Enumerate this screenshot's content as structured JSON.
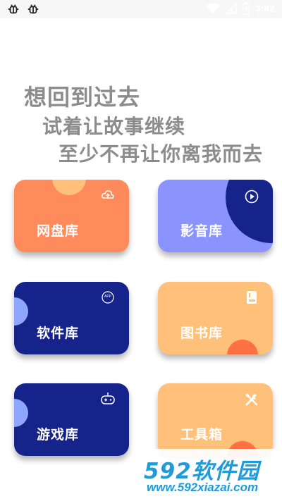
{
  "status_bar": {
    "time": "3:42",
    "left_icons": [
      "bug-icon",
      "bug-icon"
    ],
    "right_icons": [
      "wifi-icon",
      "signal-off-icon",
      "battery-charging-icon"
    ]
  },
  "quote": {
    "line1": "想回到过去",
    "line2": "试着让故事继续",
    "line3": "至少不再让你离我而去"
  },
  "cards": [
    {
      "label": "网盘库",
      "icon": "cloud-upload-icon",
      "bg": "#ff8a5b",
      "accent": "#ffc17a"
    },
    {
      "label": "影音库",
      "icon": "play-circle-icon",
      "bg": "#8b93ff",
      "accent": "#16238a"
    },
    {
      "label": "软件库",
      "icon": "app-icon",
      "icon_text": "APP",
      "bg": "#16238a",
      "accent": "#8fa6ff"
    },
    {
      "label": "图书库",
      "icon": "book-icon",
      "bg": "#ffc17a",
      "accent": "#ff7043"
    },
    {
      "label": "游戏库",
      "icon": "gamepad-icon",
      "bg": "#16238a",
      "accent": "#8fa6ff"
    },
    {
      "label": "工具箱",
      "icon": "tools-icon",
      "bg": "#ffc17a",
      "accent": "#ff7043"
    }
  ],
  "watermark": {
    "brand": "592软件园",
    "url": "www.592xiazai.com"
  }
}
